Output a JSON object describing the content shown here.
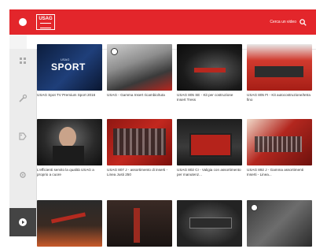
{
  "header": {
    "logo_text": "USAG",
    "search_label": "Cerca un video"
  },
  "sidebar": {
    "items": [
      {
        "icon": "grid-icon"
      },
      {
        "icon": "wrench-icon"
      },
      {
        "icon": "tag-icon"
      },
      {
        "icon": "settings-icon"
      },
      {
        "icon": "play-icon",
        "active": true
      }
    ]
  },
  "videos": [
    {
      "caption": "USAG Spot TV Premium Sport 2016",
      "thumb_text": "SPORT",
      "thumb_sub": "USAG"
    },
    {
      "caption": "USAG - Gamma Insert ricambio/tuta",
      "thumb_text": "",
      "thumb_sub": ""
    },
    {
      "caption": "USAG 805 SE - Kit per costruzione Insert Tress",
      "thumb_text": "",
      "thumb_sub": ""
    },
    {
      "caption": "USAG 805 FI - Kit autocostruzione/tetra fino",
      "thumb_text": "",
      "thumb_sub": ""
    },
    {
      "caption": "L'efficienti servito la qualità USAG a proprio a cuore",
      "thumb_text": "",
      "thumb_sub": ""
    },
    {
      "caption": "USAG 807 J - assortimento di inserti - Linea Justi 250",
      "thumb_text": "",
      "thumb_sub": ""
    },
    {
      "caption": "USAG 802 CI - Valigia con assortimento per manutenz...",
      "thumb_text": "",
      "thumb_sub": ""
    },
    {
      "caption": "USAG 892 J - Gamma assortimenti Inserti - Linea...",
      "thumb_text": "",
      "thumb_sub": ""
    },
    {
      "caption": "",
      "thumb_text": "",
      "thumb_sub": ""
    },
    {
      "caption": "",
      "thumb_text": "",
      "thumb_sub": ""
    },
    {
      "caption": "",
      "thumb_text": "",
      "thumb_sub": ""
    },
    {
      "caption": "",
      "thumb_text": "",
      "thumb_sub": ""
    }
  ],
  "colors": {
    "brand_red": "#e3262b",
    "sidebar_bg": "#ececec",
    "sidebar_active": "#444444"
  }
}
